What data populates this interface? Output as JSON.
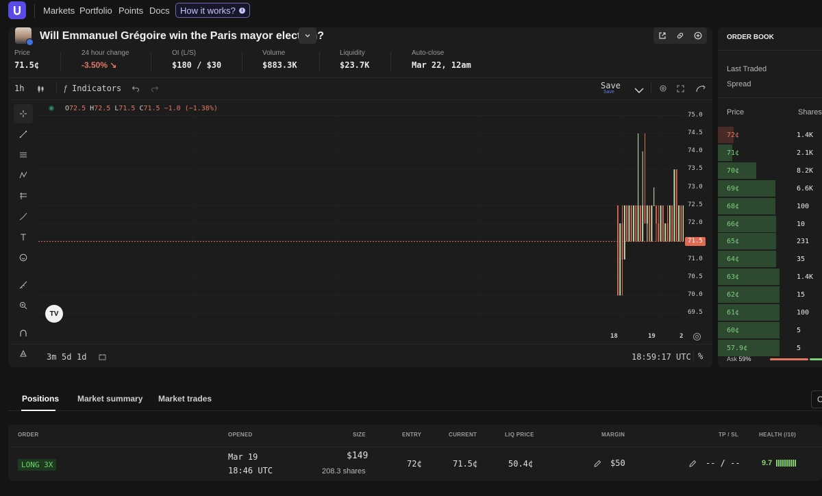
{
  "nav": {
    "items": [
      "Markets",
      "Portfolio",
      "Points",
      "Docs"
    ],
    "how_it_works": "How it works?"
  },
  "market": {
    "question": "Will Emmanuel Grégoire win the Paris mayor election?",
    "stats": [
      {
        "label": "Price",
        "value": "71.5¢",
        "color": "#e8e8e8"
      },
      {
        "label": "24 hour change",
        "value": "-3.50% ↘",
        "color": "#e07862"
      },
      {
        "label": "OI (L/S)",
        "value": "$180 / $30",
        "color": "#e8e8e8"
      },
      {
        "label": "Volume",
        "value": "$883.3K",
        "color": "#e8e8e8"
      },
      {
        "label": "Liquidity",
        "value": "$23.7K",
        "color": "#e8e8e8"
      },
      {
        "label": "Auto-close",
        "value": "Mar 22, 12am",
        "color": "#e8e8e8"
      }
    ]
  },
  "chart_toolbar": {
    "interval": "1h",
    "indicators": "Indicators",
    "save": "Save",
    "save_sub": "Save"
  },
  "ohlc": {
    "o_key": "O",
    "o_val": "72.5",
    "h_key": "H",
    "h_val": "72.5",
    "l_key": "L",
    "l_val": "71.5",
    "c_key": "C",
    "c_val": "71.5 −1.0 (−1.38%)"
  },
  "chart_bottom": {
    "ranges": [
      "3m",
      "5d",
      "1d"
    ],
    "clock": "18:59:17 UTC",
    "percent": "%"
  },
  "chart_data": {
    "type": "candlestick",
    "current_price": 71.5,
    "ylim": [
      69.3,
      75.2
    ],
    "y_ticks": [
      75.0,
      74.5,
      74.0,
      73.5,
      73.0,
      72.5,
      72.0,
      71.5,
      71.0,
      70.5,
      70.0,
      69.5
    ],
    "x_ticks": [
      "18",
      "19",
      "2"
    ],
    "candles": [
      {
        "o": 72.5,
        "h": 72.5,
        "l": 70.0,
        "c": 70.0
      },
      {
        "o": 70.0,
        "h": 72.0,
        "l": 70.0,
        "c": 72.0
      },
      {
        "o": 72.0,
        "h": 72.5,
        "l": 70.0,
        "c": 71.0
      },
      {
        "o": 71.0,
        "h": 72.5,
        "l": 71.0,
        "c": 72.5
      },
      {
        "o": 72.5,
        "h": 72.5,
        "l": 71.5,
        "c": 71.5
      },
      {
        "o": 71.5,
        "h": 72.5,
        "l": 71.5,
        "c": 72.5
      },
      {
        "o": 72.5,
        "h": 72.5,
        "l": 71.5,
        "c": 71.5
      },
      {
        "o": 71.5,
        "h": 72.5,
        "l": 71.5,
        "c": 72.5
      },
      {
        "o": 72.5,
        "h": 72.5,
        "l": 71.5,
        "c": 71.5
      },
      {
        "o": 71.5,
        "h": 74.5,
        "l": 71.5,
        "c": 72.5
      },
      {
        "o": 72.5,
        "h": 72.5,
        "l": 71.5,
        "c": 71.5
      },
      {
        "o": 71.5,
        "h": 74.0,
        "l": 71.5,
        "c": 72.5
      },
      {
        "o": 72.5,
        "h": 74.5,
        "l": 72.0,
        "c": 72.0
      },
      {
        "o": 72.0,
        "h": 72.5,
        "l": 71.5,
        "c": 72.5
      },
      {
        "o": 72.5,
        "h": 72.5,
        "l": 71.5,
        "c": 71.5
      },
      {
        "o": 71.5,
        "h": 72.5,
        "l": 71.5,
        "c": 72.5
      },
      {
        "o": 72.5,
        "h": 73.0,
        "l": 72.5,
        "c": 72.5
      },
      {
        "o": 72.5,
        "h": 72.5,
        "l": 71.5,
        "c": 72.0
      },
      {
        "o": 72.0,
        "h": 72.5,
        "l": 71.5,
        "c": 71.5
      },
      {
        "o": 71.5,
        "h": 72.5,
        "l": 71.5,
        "c": 72.5
      },
      {
        "o": 72.5,
        "h": 72.5,
        "l": 71.5,
        "c": 71.5
      },
      {
        "o": 71.5,
        "h": 72.0,
        "l": 71.5,
        "c": 72.0
      },
      {
        "o": 72.0,
        "h": 72.5,
        "l": 71.5,
        "c": 71.5
      },
      {
        "o": 71.5,
        "h": 72.5,
        "l": 71.5,
        "c": 72.5
      },
      {
        "o": 72.5,
        "h": 72.5,
        "l": 71.5,
        "c": 71.5
      },
      {
        "o": 71.5,
        "h": 73.5,
        "l": 71.5,
        "c": 73.5
      },
      {
        "o": 73.5,
        "h": 73.5,
        "l": 71.5,
        "c": 71.5
      },
      {
        "o": 71.5,
        "h": 72.5,
        "l": 71.5,
        "c": 72.5
      },
      {
        "o": 72.5,
        "h": 72.5,
        "l": 71.5,
        "c": 71.5
      },
      {
        "o": 71.5,
        "h": 72.5,
        "l": 71.5,
        "c": 72.5
      },
      {
        "o": 72.5,
        "h": 73.0,
        "l": 71.5,
        "c": 71.5
      },
      {
        "o": 71.5,
        "h": 73.5,
        "l": 71.5,
        "c": 73.5
      },
      {
        "o": 73.5,
        "h": 73.5,
        "l": 71.5,
        "c": 71.5
      },
      {
        "o": 71.5,
        "h": 72.5,
        "l": 71.5,
        "c": 71.5
      }
    ],
    "up_color": "#c9e6b3",
    "down_color": "#e06a54"
  },
  "order_book": {
    "title": "ORDER BOOK",
    "last_traded": "Last Traded",
    "spread": "Spread",
    "col_price": "Price",
    "col_shares": "Shares",
    "rows": [
      {
        "price": "72¢",
        "shares": "1.4K",
        "side": "ask",
        "depth": 0.15
      },
      {
        "price": "71¢",
        "shares": "2.1K",
        "side": "bid",
        "depth": 0.14
      },
      {
        "price": "70¢",
        "shares": "8.2K",
        "side": "bid",
        "depth": 0.37
      },
      {
        "price": "69¢",
        "shares": "6.6K",
        "side": "bid",
        "depth": 0.55
      },
      {
        "price": "68¢",
        "shares": "100",
        "side": "bid",
        "depth": 0.55
      },
      {
        "price": "66¢",
        "shares": "10",
        "side": "bid",
        "depth": 0.56
      },
      {
        "price": "65¢",
        "shares": "231",
        "side": "bid",
        "depth": 0.56
      },
      {
        "price": "64¢",
        "shares": "35",
        "side": "bid",
        "depth": 0.56
      },
      {
        "price": "63¢",
        "shares": "1.4K",
        "side": "bid",
        "depth": 0.59
      },
      {
        "price": "62¢",
        "shares": "15",
        "side": "bid",
        "depth": 0.59
      },
      {
        "price": "61¢",
        "shares": "100",
        "side": "bid",
        "depth": 0.59
      },
      {
        "price": "60¢",
        "shares": "5",
        "side": "bid",
        "depth": 0.59
      },
      {
        "price": "57.9¢",
        "shares": "5",
        "side": "bid",
        "depth": 0.59
      }
    ],
    "ask_label": "Ask",
    "ask_pct": "59%",
    "ask_color": "#e07862",
    "bid_color": "#7fd07d"
  },
  "tabs": {
    "items": [
      "Positions",
      "Market summary",
      "Market trades"
    ],
    "right_button": "O"
  },
  "positions": {
    "headers": [
      "ORDER",
      "OPENED",
      "SIZE",
      "ENTRY",
      "CURRENT",
      "LIQ PRICE",
      "MARGIN",
      "TP / SL",
      "HEALTH (/10)"
    ],
    "row": {
      "order": "LONG 3X",
      "opened_date": "Mar 19",
      "opened_time": "18:46 UTC",
      "size": "$149",
      "size_shares": "208.3 shares",
      "entry": "72¢",
      "current": "71.5¢",
      "liq_price": "50.4¢",
      "margin": "$50",
      "tp_sl": "-- / --",
      "health": "9.7",
      "health_level": 0.97
    }
  }
}
